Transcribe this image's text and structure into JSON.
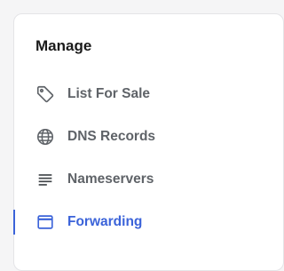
{
  "card": {
    "title": "Manage"
  },
  "nav": {
    "items": [
      {
        "label": "List For Sale",
        "icon": "tag-icon",
        "active": false
      },
      {
        "label": "DNS Records",
        "icon": "globe-icon",
        "active": false
      },
      {
        "label": "Nameservers",
        "icon": "lines-icon",
        "active": false
      },
      {
        "label": "Forwarding",
        "icon": "window-icon",
        "active": true
      }
    ]
  },
  "colors": {
    "accent": "#3b63d9",
    "text_muted": "#5f6368",
    "title": "#1a1a1a",
    "card_border": "#e4e4e7",
    "page_background": "#f5f5f6"
  }
}
